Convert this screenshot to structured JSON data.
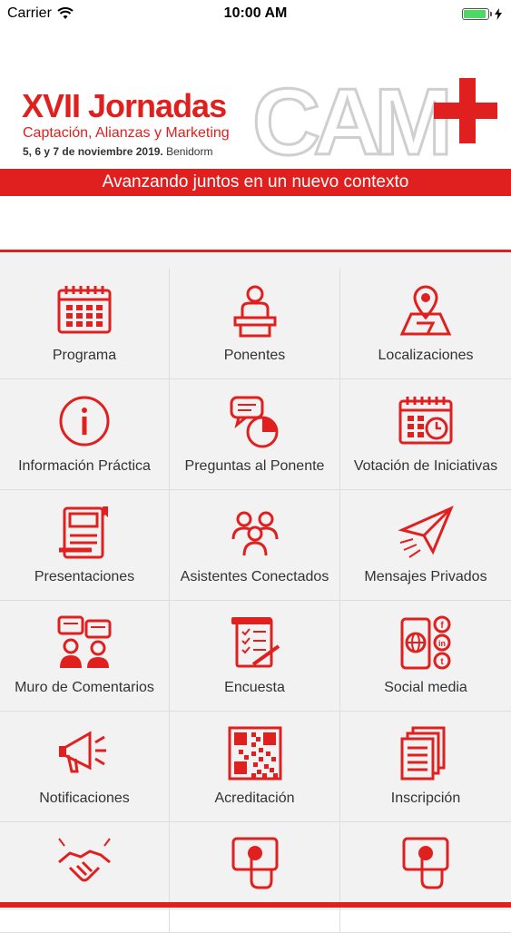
{
  "status": {
    "carrier": "Carrier",
    "time": "10:00 AM",
    "battery_level": 0.95
  },
  "banner": {
    "title": "XVII Jornadas",
    "subtitle": "Captación, Alianzas y Marketing",
    "date_bold": "5, 6 y 7 de noviembre 2019.",
    "location": "Benidorm",
    "logo_text": "CAM",
    "slogan": "Avanzando juntos en un nuevo contexto"
  },
  "colors": {
    "accent": "#e0201f"
  },
  "menu": [
    {
      "label": "Programa",
      "icon": "calendar-icon"
    },
    {
      "label": "Ponentes",
      "icon": "speaker-podium-icon"
    },
    {
      "label": "Localizaciones",
      "icon": "map-pin-icon"
    },
    {
      "label": "Información Práctica",
      "icon": "info-icon"
    },
    {
      "label": "Preguntas al Ponente",
      "icon": "chat-pie-icon"
    },
    {
      "label": "Votación de Iniciativas",
      "icon": "calendar-clock-icon"
    },
    {
      "label": "Presentaciones",
      "icon": "notebook-icon"
    },
    {
      "label": "Asistentes Conectados",
      "icon": "people-group-icon"
    },
    {
      "label": "Mensajes Privados",
      "icon": "paper-plane-icon"
    },
    {
      "label": "Muro de Comentarios",
      "icon": "comments-wall-icon"
    },
    {
      "label": "Encuesta",
      "icon": "survey-icon"
    },
    {
      "label": "Social media",
      "icon": "social-media-icon"
    },
    {
      "label": "Notificaciones",
      "icon": "megaphone-icon"
    },
    {
      "label": "Acreditación",
      "icon": "qr-code-icon"
    },
    {
      "label": "Inscripción",
      "icon": "documents-icon"
    },
    {
      "label": "",
      "icon": "handshake-icon"
    },
    {
      "label": "",
      "icon": "tablet-touch-icon"
    },
    {
      "label": "",
      "icon": "tablet-touch-icon-2"
    }
  ]
}
